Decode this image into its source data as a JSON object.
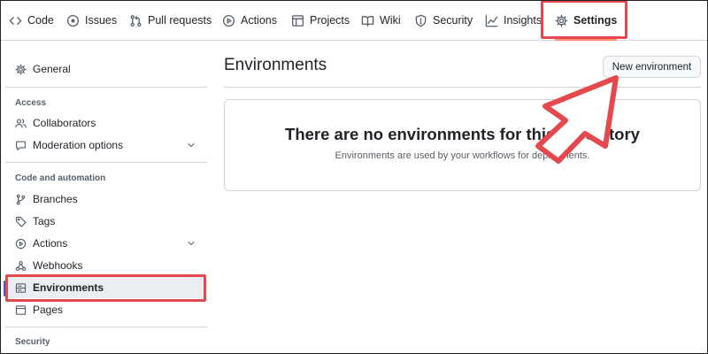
{
  "nav": {
    "tabs": [
      {
        "label": "Code",
        "icon": "code-icon"
      },
      {
        "label": "Issues",
        "icon": "issue-circle-icon"
      },
      {
        "label": "Pull requests",
        "icon": "pull-request-icon"
      },
      {
        "label": "Actions",
        "icon": "play-icon"
      },
      {
        "label": "Projects",
        "icon": "table-icon"
      },
      {
        "label": "Wiki",
        "icon": "book-icon"
      },
      {
        "label": "Security",
        "icon": "shield-icon"
      },
      {
        "label": "Insights",
        "icon": "graph-icon"
      },
      {
        "label": "Settings",
        "icon": "gear-icon"
      }
    ],
    "active_tab": "Settings"
  },
  "sidebar": {
    "general": {
      "label": "General",
      "icon": "gear-icon"
    },
    "access_heading": "Access",
    "access_items": [
      {
        "label": "Collaborators",
        "icon": "people-icon"
      },
      {
        "label": "Moderation options",
        "icon": "comment-icon",
        "expandable": true
      }
    ],
    "code_heading": "Code and automation",
    "code_items": [
      {
        "label": "Branches",
        "icon": "branch-icon"
      },
      {
        "label": "Tags",
        "icon": "tag-icon"
      },
      {
        "label": "Actions",
        "icon": "play-icon",
        "expandable": true
      },
      {
        "label": "Webhooks",
        "icon": "webhook-icon"
      },
      {
        "label": "Environments",
        "icon": "server-icon",
        "selected": true
      },
      {
        "label": "Pages",
        "icon": "browser-icon"
      }
    ],
    "security_heading": "Security"
  },
  "main": {
    "title": "Environments",
    "new_button": "New environment",
    "empty_heading": "There are no environments for this repository",
    "empty_description": "Environments are used by your workflows for deployments."
  },
  "colors": {
    "highlight": "#e5484d",
    "active_underline": "#fd8c73",
    "selected_marker": "#5b4fc7"
  }
}
